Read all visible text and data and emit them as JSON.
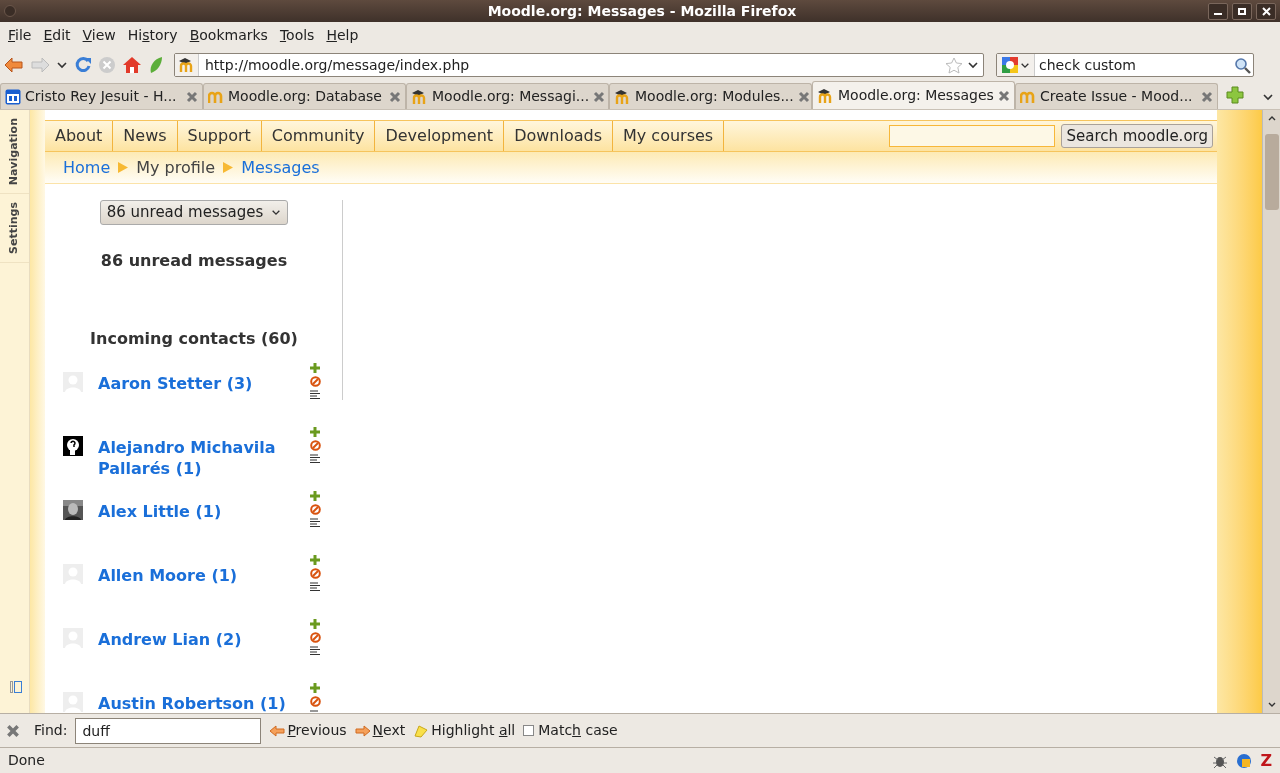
{
  "window": {
    "title": "Moodle.org: Messages - Mozilla Firefox"
  },
  "menu": [
    {
      "key": "F",
      "post": "ile"
    },
    {
      "key": "E",
      "post": "dit"
    },
    {
      "key": "V",
      "post": "iew"
    },
    {
      "pre": "Hi",
      "key": "s",
      "post": "tory"
    },
    {
      "key": "B",
      "post": "ookmarks"
    },
    {
      "key": "T",
      "post": "ools"
    },
    {
      "key": "H",
      "post": "elp"
    }
  ],
  "address": {
    "value": "http://moodle.org/message/index.php"
  },
  "search": {
    "value": "check custom"
  },
  "tabs": [
    {
      "label": "Cristo Rey Jesuit - H...",
      "kind": "calendar",
      "selected": false
    },
    {
      "label": "Moodle.org: Database",
      "kind": "plain",
      "selected": false
    },
    {
      "label": "Moodle.org: Messagi...",
      "kind": "capped",
      "selected": false
    },
    {
      "label": "Moodle.org: Modules...",
      "kind": "capped",
      "selected": false
    },
    {
      "label": "Moodle.org: Messages",
      "kind": "capped",
      "selected": true
    },
    {
      "label": "Create Issue - Mood...",
      "kind": "plain",
      "selected": false
    }
  ],
  "side_tabs": [
    "Navigation",
    "Settings"
  ],
  "site_nav": [
    "About",
    "News",
    "Support",
    "Community",
    "Development",
    "Downloads",
    "My courses"
  ],
  "site_search": {
    "button": "Search moodle.org"
  },
  "breadcrumb": [
    {
      "label": "Home",
      "link": true
    },
    {
      "label": "My profile",
      "link": false
    },
    {
      "label": "Messages",
      "link": true
    }
  ],
  "messages": {
    "dropdown": "86 unread messages",
    "heading": "86 unread messages",
    "contacts_heading": "Incoming contacts (60)",
    "contacts": [
      {
        "name": "Aaron Stetter (3)",
        "kind": "blank"
      },
      {
        "name": "Alejandro Michavila Pallarés (1)",
        "kind": "unknown"
      },
      {
        "name": "Alex Little (1)"
      },
      {
        "name": "Allen Moore (1)",
        "kind": "blank"
      },
      {
        "name": "Andrew Lian (2)",
        "kind": "blank"
      },
      {
        "name": "Austin Robertson (1)",
        "kind": "blank"
      }
    ]
  },
  "find_bar": {
    "label": "Find:",
    "value": "duff",
    "previous": {
      "key": "P",
      "post": "revious"
    },
    "next": {
      "key": "N",
      "post": "ext"
    },
    "highlight": {
      "pre": "Highlight ",
      "key": "a",
      "post": "ll"
    },
    "match_case": {
      "pre": "Matc",
      "key": "h",
      "post": " case"
    },
    "match_case_checked": false
  },
  "status_bar": {
    "text": "Done",
    "badge": "Z"
  }
}
